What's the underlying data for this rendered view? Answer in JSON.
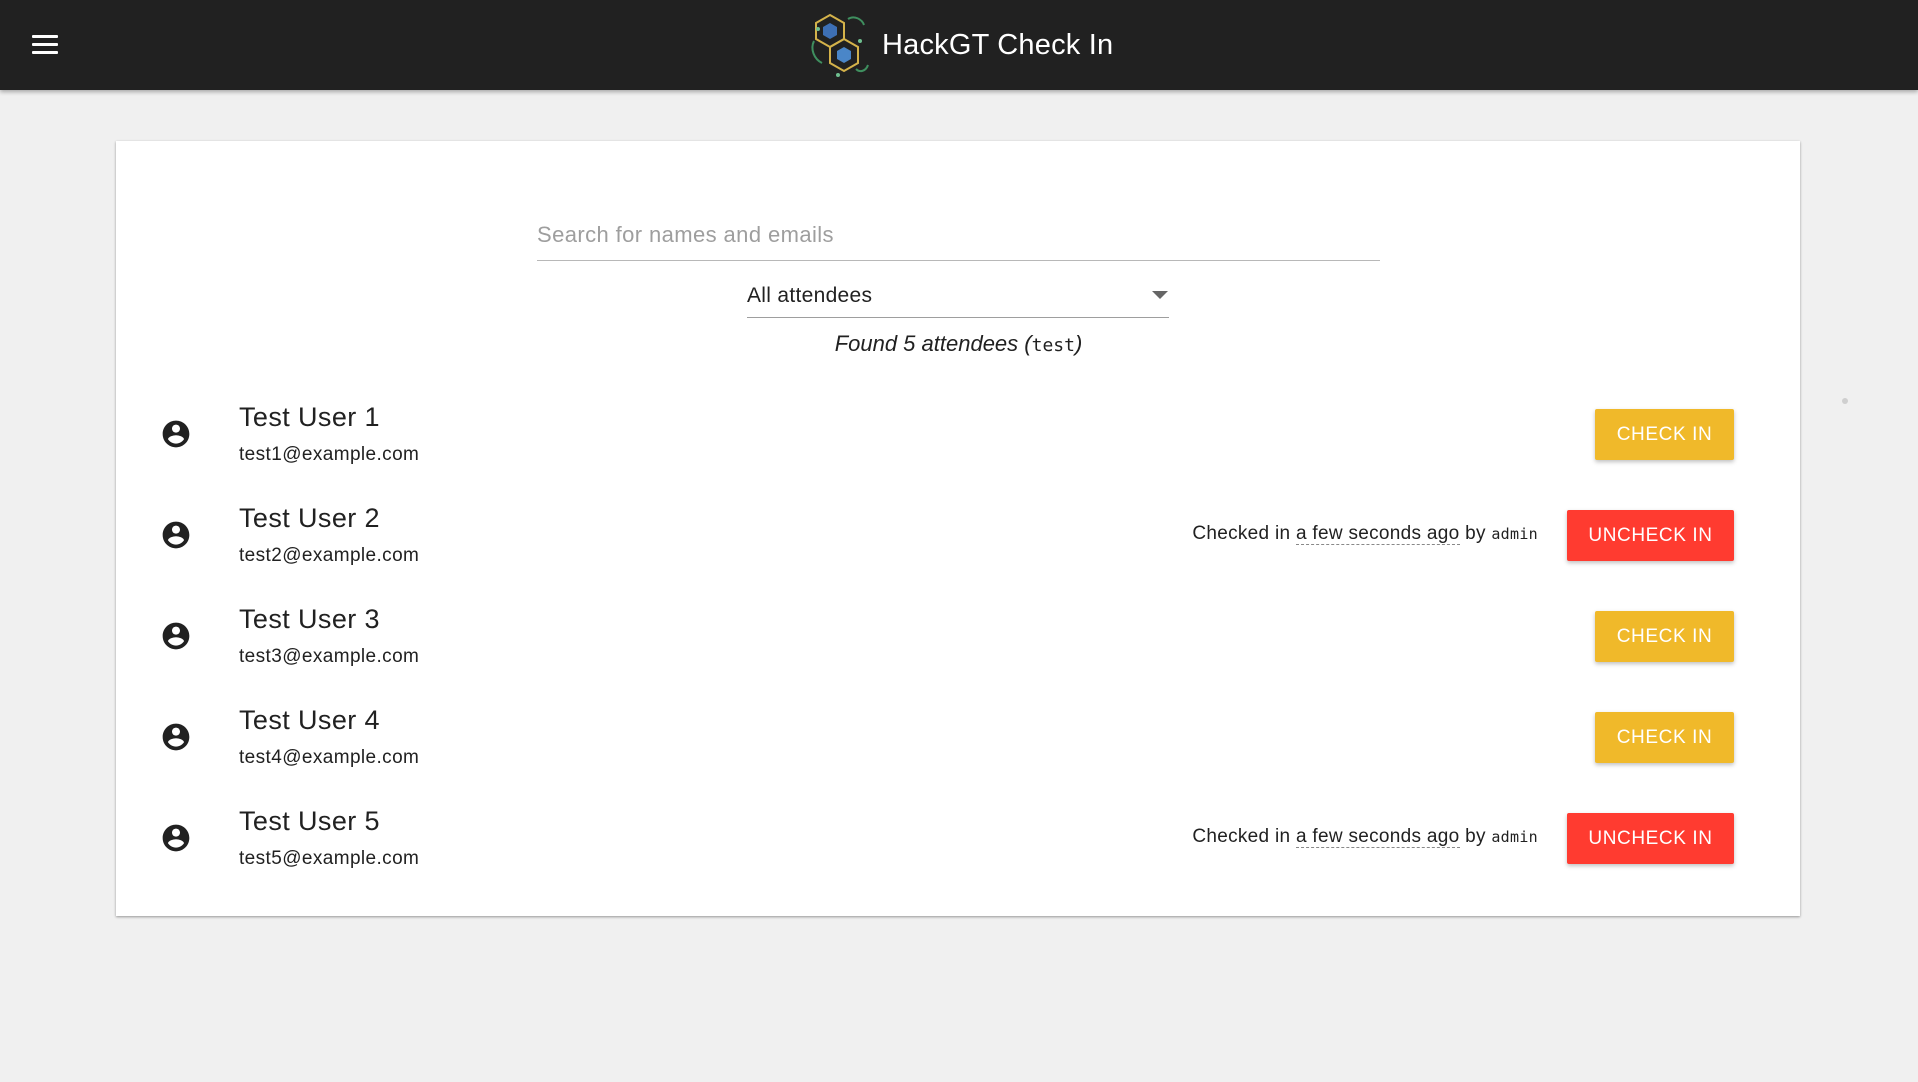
{
  "header": {
    "title": "HackGT Check In",
    "menu_icon": "hamburger-menu-icon",
    "logo_icon": "hackgt-hexagon-logo-icon",
    "background_color": "#212121"
  },
  "search": {
    "placeholder": "Search for names and emails",
    "value": ""
  },
  "filter": {
    "selected": "All attendees"
  },
  "results": {
    "summary_prefix": "Found 5 attendees (",
    "query": "test",
    "summary_suffix": ")"
  },
  "attendees": [
    {
      "name": "Test User 1",
      "email": "test1@example.com",
      "checked_in": false,
      "button_label": "Check in"
    },
    {
      "name": "Test User 2",
      "email": "test2@example.com",
      "checked_in": true,
      "status_prefix": "Checked in ",
      "status_when": "a few seconds ago",
      "status_by": " by ",
      "status_user": "admin",
      "button_label": "Uncheck in"
    },
    {
      "name": "Test User 3",
      "email": "test3@example.com",
      "checked_in": false,
      "button_label": "Check in"
    },
    {
      "name": "Test User 4",
      "email": "test4@example.com",
      "checked_in": false,
      "button_label": "Check in"
    },
    {
      "name": "Test User 5",
      "email": "test5@example.com",
      "checked_in": true,
      "status_prefix": "Checked in ",
      "status_when": "a few seconds ago",
      "status_by": " by ",
      "status_user": "admin",
      "button_label": "Uncheck in"
    }
  ],
  "colors": {
    "check_in": "#f0b92a",
    "uncheck_in": "#ff3b30",
    "page_background": "#f0f0f0"
  }
}
